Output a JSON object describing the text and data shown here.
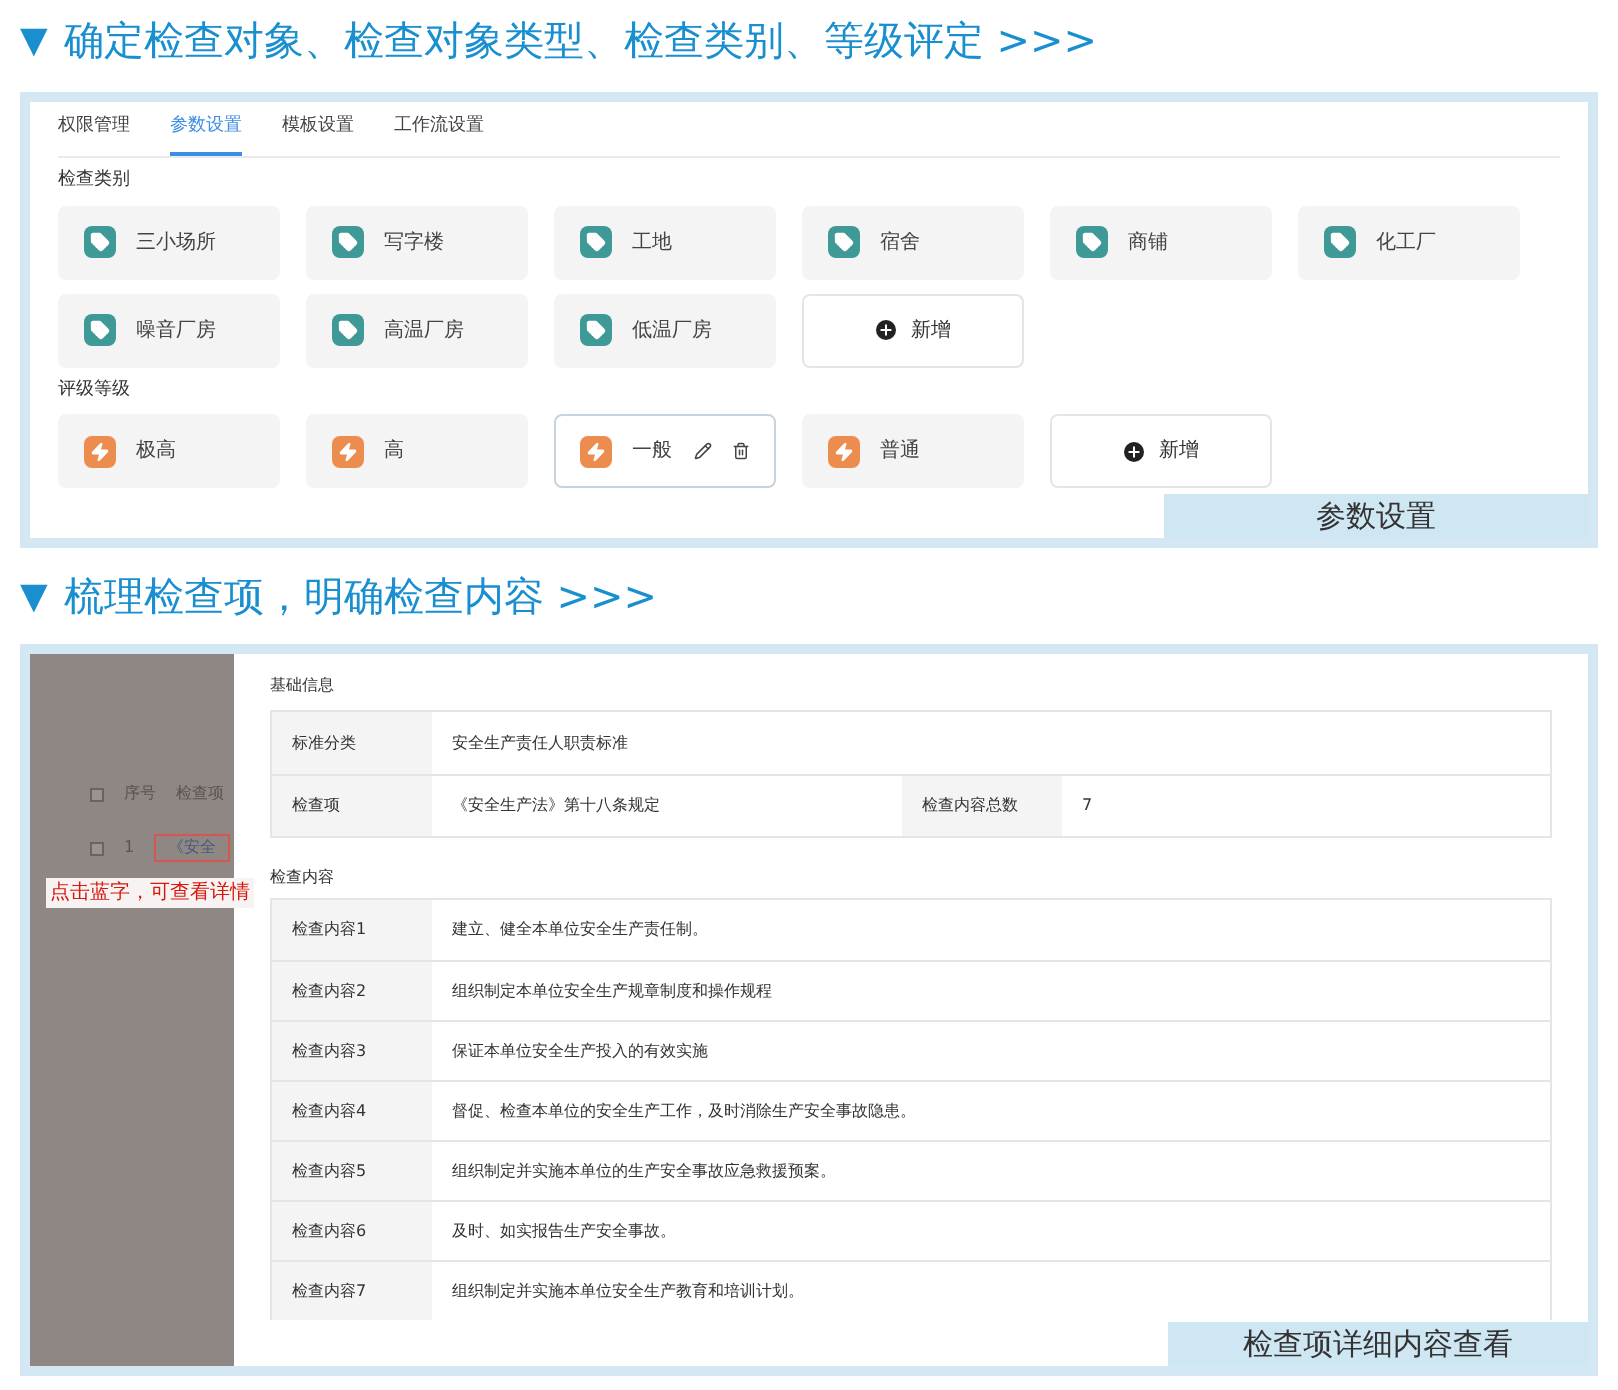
{
  "heading_1": {
    "marker": "▼",
    "text": "确定检查对象、检查对象类型、检查类别、等级评定 >>>"
  },
  "settings_panel": {
    "tabs": [
      {
        "label": "权限管理",
        "selected": false
      },
      {
        "label": "参数设置",
        "selected": true
      },
      {
        "label": "模板设置",
        "selected": false
      },
      {
        "label": "工作流设置",
        "selected": false
      }
    ],
    "sections": [
      {
        "title": "检查类别",
        "items": [
          {
            "kind": "item",
            "label": "三小场所",
            "selected": false
          },
          {
            "kind": "item",
            "label": "写字楼",
            "selected": false
          },
          {
            "kind": "item",
            "label": "工地",
            "selected": false
          },
          {
            "kind": "item",
            "label": "宿舍",
            "selected": false
          },
          {
            "kind": "item",
            "label": "商铺",
            "selected": false
          },
          {
            "kind": "item",
            "label": "化工厂",
            "selected": false
          },
          {
            "kind": "item",
            "label": "噪音厂房",
            "selected": false
          },
          {
            "kind": "item",
            "label": "高温厂房",
            "selected": false
          },
          {
            "kind": "item",
            "label": "低温厂房",
            "selected": false
          },
          {
            "kind": "add",
            "label": "新增"
          }
        ]
      },
      {
        "title": "评级等级",
        "items": [
          {
            "kind": "item",
            "label": "极高",
            "selected": false
          },
          {
            "kind": "item",
            "label": "高",
            "selected": false
          },
          {
            "kind": "item",
            "label": "一般",
            "selected": true
          },
          {
            "kind": "item",
            "label": "普通",
            "selected": false
          },
          {
            "kind": "add",
            "label": "新增"
          }
        ]
      }
    ],
    "caption": "参数设置"
  },
  "heading_2": {
    "marker": "▼",
    "text": "梳理检查项，明确检查内容 >>>"
  },
  "detail_panel": {
    "background_list": {
      "header_checked": false,
      "columns": [
        "序号",
        "检查项"
      ],
      "rows": [
        {
          "checked": false,
          "index": "1",
          "item": "《安全"
        }
      ]
    },
    "annotation": "点击蓝字，可查看详情",
    "basic_title": "基础信息",
    "basic_rows": [
      [
        {
          "label": "标准分类",
          "value": "安全生产责任人职责标准"
        }
      ],
      [
        {
          "label": "检查项",
          "value": "《安全生产法》第十八条规定"
        },
        {
          "label": "检查内容总数",
          "value": "7"
        }
      ]
    ],
    "content_title": "检查内容",
    "contents": [
      {
        "label": "检查内容1",
        "text": "建立、健全本单位安全生产责任制。"
      },
      {
        "label": "检查内容2",
        "text": "组织制定本单位安全生产规章制度和操作规程"
      },
      {
        "label": "检查内容3",
        "text": "保证本单位安全生产投入的有效实施"
      },
      {
        "label": "检查内容4",
        "text": "督促、检查本单位的安全生产工作，及时消除生产安全事故隐患。"
      },
      {
        "label": "检查内容5",
        "text": "组织制定并实施本单位的生产安全事故应急救援预案。"
      },
      {
        "label": "检查内容6",
        "text": "及时、如实报告生产安全事故。"
      },
      {
        "label": "检查内容7",
        "text": "组织制定并实施本单位安全生产教育和培训计划。"
      }
    ],
    "caption": "检查项详细内容查看"
  }
}
